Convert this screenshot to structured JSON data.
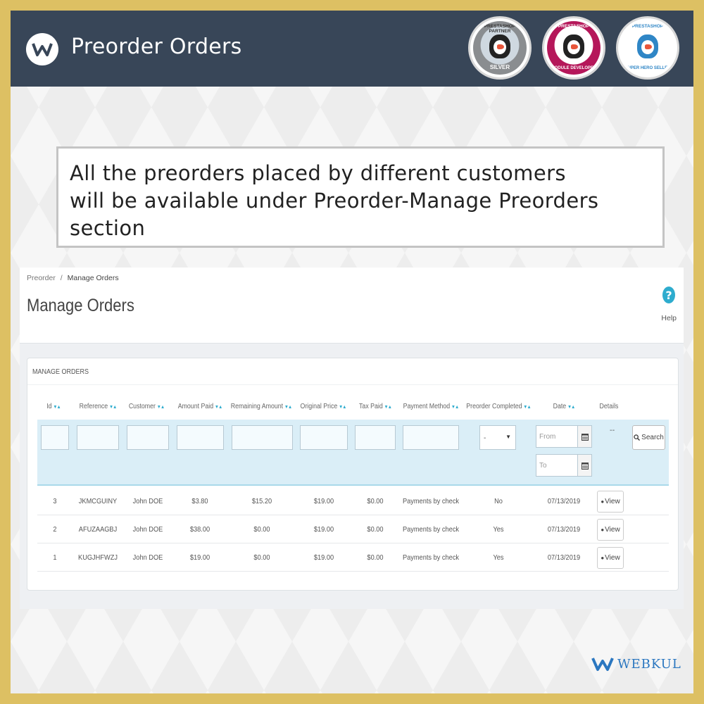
{
  "header": {
    "title": "Preorder Orders",
    "logo_icon": "webkul-w-logo-icon",
    "badges": [
      {
        "top": "PRESTASHOP PARTNER",
        "bottom": "SILVER",
        "color": "#8a8d90"
      },
      {
        "top": "PRESTASHOP PARTNER",
        "bottom": "MODULE DEVELOPER",
        "color": "#b5175a"
      },
      {
        "top": "PRESTASHOP",
        "bottom": "SUPER HERO SELLER",
        "color": "#2f86c6"
      }
    ]
  },
  "callout": {
    "line1": "All the preorders placed by different customers",
    "line2": "will be available under Preorder-Manage Preorders",
    "line3": "section"
  },
  "page": {
    "breadcrumb_parent": "Preorder",
    "breadcrumb_sep": "/",
    "breadcrumb_current": "Manage Orders",
    "title": "Manage Orders",
    "help_label": "Help"
  },
  "table": {
    "heading": "MANAGE ORDERS",
    "columns": [
      "Id",
      "Reference",
      "Customer",
      "Amount Paid",
      "Remaining Amount",
      "Original Price",
      "Tax Paid",
      "Payment Method",
      "Preorder Completed",
      "Date",
      "Details"
    ],
    "filters": {
      "completed_selected": "-",
      "date_from_placeholder": "From",
      "date_to_placeholder": "To",
      "details_dash": "--",
      "search_label": "Search"
    },
    "rows": [
      {
        "id": "3",
        "reference": "JKMCGUINY",
        "customer": "John DOE",
        "amount_paid": "$3.80",
        "remaining": "$15.20",
        "original_price": "$19.00",
        "tax_paid": "$0.00",
        "payment_method": "Payments by check",
        "completed": "No",
        "date": "07/13/2019",
        "view_label": "View"
      },
      {
        "id": "2",
        "reference": "AFUZAAGBJ",
        "customer": "John DOE",
        "amount_paid": "$38.00",
        "remaining": "$0.00",
        "original_price": "$19.00",
        "tax_paid": "$0.00",
        "payment_method": "Payments by check",
        "completed": "Yes",
        "date": "07/13/2019",
        "view_label": "View"
      },
      {
        "id": "1",
        "reference": "KUGJHFWZJ",
        "customer": "John DOE",
        "amount_paid": "$19.00",
        "remaining": "$0.00",
        "original_price": "$19.00",
        "tax_paid": "$0.00",
        "payment_method": "Payments by check",
        "completed": "Yes",
        "date": "07/13/2019",
        "view_label": "View"
      }
    ]
  },
  "footer": {
    "brand": "WEBKUL"
  },
  "colors": {
    "outer_border": "#ddc063",
    "topbar": "#384658",
    "accent": "#2eacce",
    "brand_blue": "#2b77c0"
  }
}
